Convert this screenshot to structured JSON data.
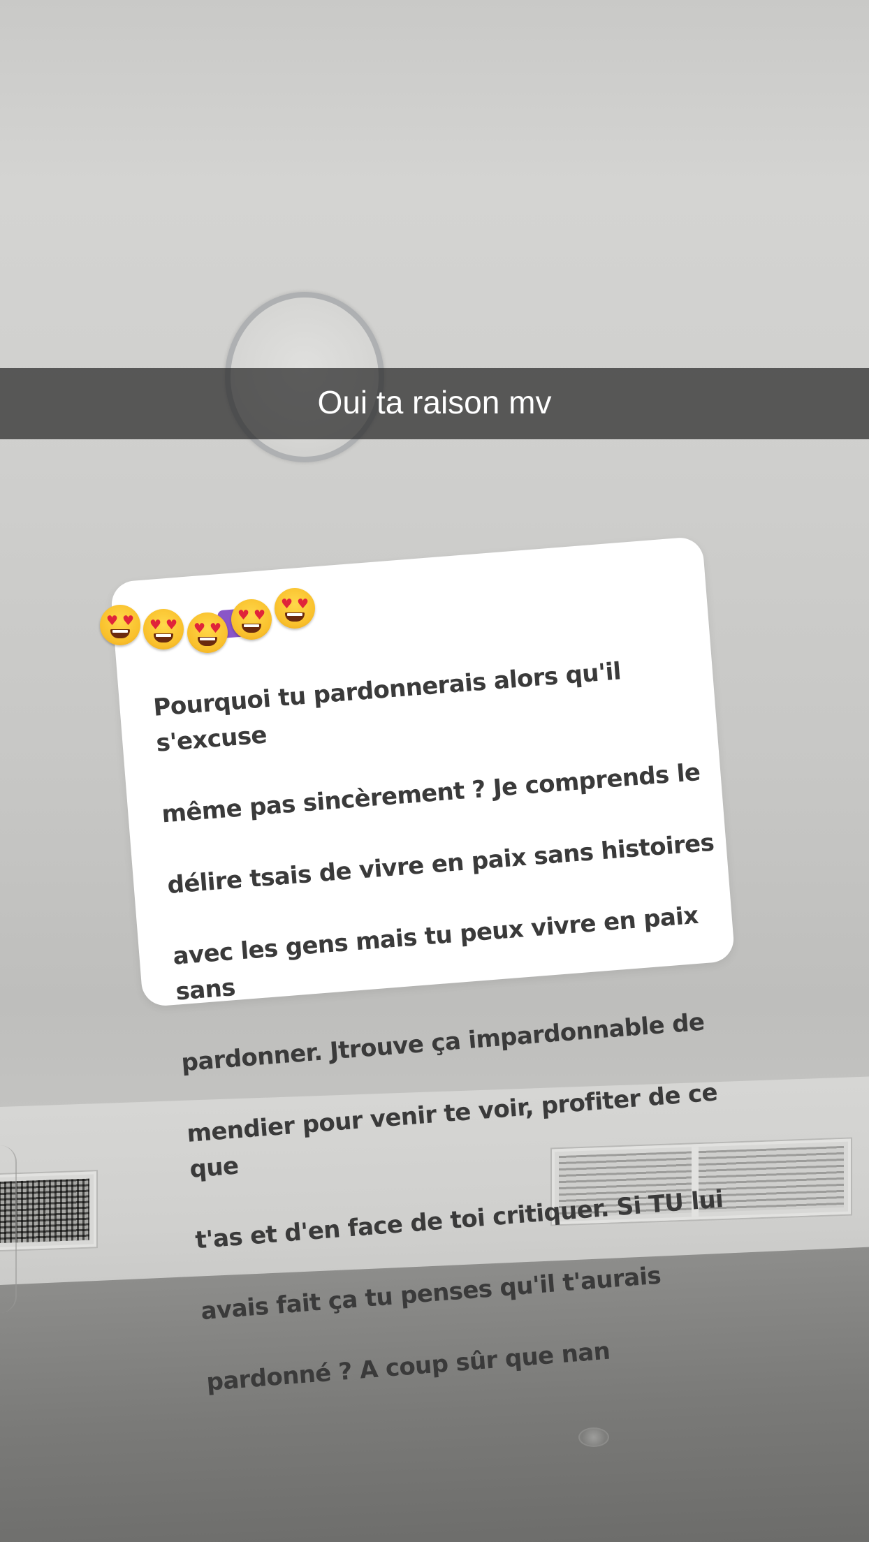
{
  "caption": {
    "text": "Oui ta raison mv"
  },
  "question_card": {
    "lines": [
      "Pourquoi tu pardonnerais alors qu'il s'excuse",
      "même pas sincèrement ? Je comprends le",
      "délire tsais de vivre en paix sans histoires",
      "avec les gens mais tu peux vivre en paix sans",
      "pardonner. Jtrouve ça impardonnable de",
      "mendier pour venir te voir, profiter de ce que",
      "t'as et d'en face de toi critiquer. Si TU lui",
      "avais fait ça tu penses qu'il t'aurais",
      "pardonné ? A coup sûr que nan"
    ]
  },
  "stickers": {
    "emoji": [
      {
        "icon": "heart-eyes-emoji-icon"
      },
      {
        "icon": "heart-eyes-emoji-icon"
      },
      {
        "icon": "heart-eyes-emoji-icon"
      },
      {
        "icon": "heart-eyes-emoji-icon"
      },
      {
        "icon": "heart-eyes-emoji-icon"
      }
    ],
    "colors": {
      "emoji_face": "#f9c02c",
      "emoji_heart": "#e0243a",
      "chip": "#8a56c8"
    }
  },
  "colors": {
    "caption_bar": "#282828",
    "caption_text": "#ffffff",
    "card_background": "#ffffff",
    "card_text": "#3a3a3a"
  }
}
